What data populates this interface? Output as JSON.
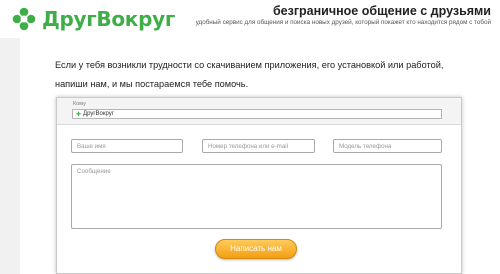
{
  "header": {
    "logo_text": "ДругВокруг",
    "tagline": "безграничное общение с друзьями",
    "tagline_sub": "удобный сервис для общения и поиска новых друзей, который покажет кто находится рядом с тобой"
  },
  "intro_text": "Если у тебя возникли трудности со скачиванием приложения, его установкой или работой, напиши нам, и мы постараемся тебе помочь.",
  "form": {
    "to_label": "Кому",
    "to_value": "ДругВокруг",
    "name_placeholder": "Ваше имя",
    "phone_placeholder": "Номер телефона или e-mail",
    "model_placeholder": "Модель телефона",
    "message_placeholder": "Сообщение",
    "submit_label": "Написать нам"
  },
  "colors": {
    "brand_green": "#3fae49",
    "submit_orange": "#f39f12"
  }
}
